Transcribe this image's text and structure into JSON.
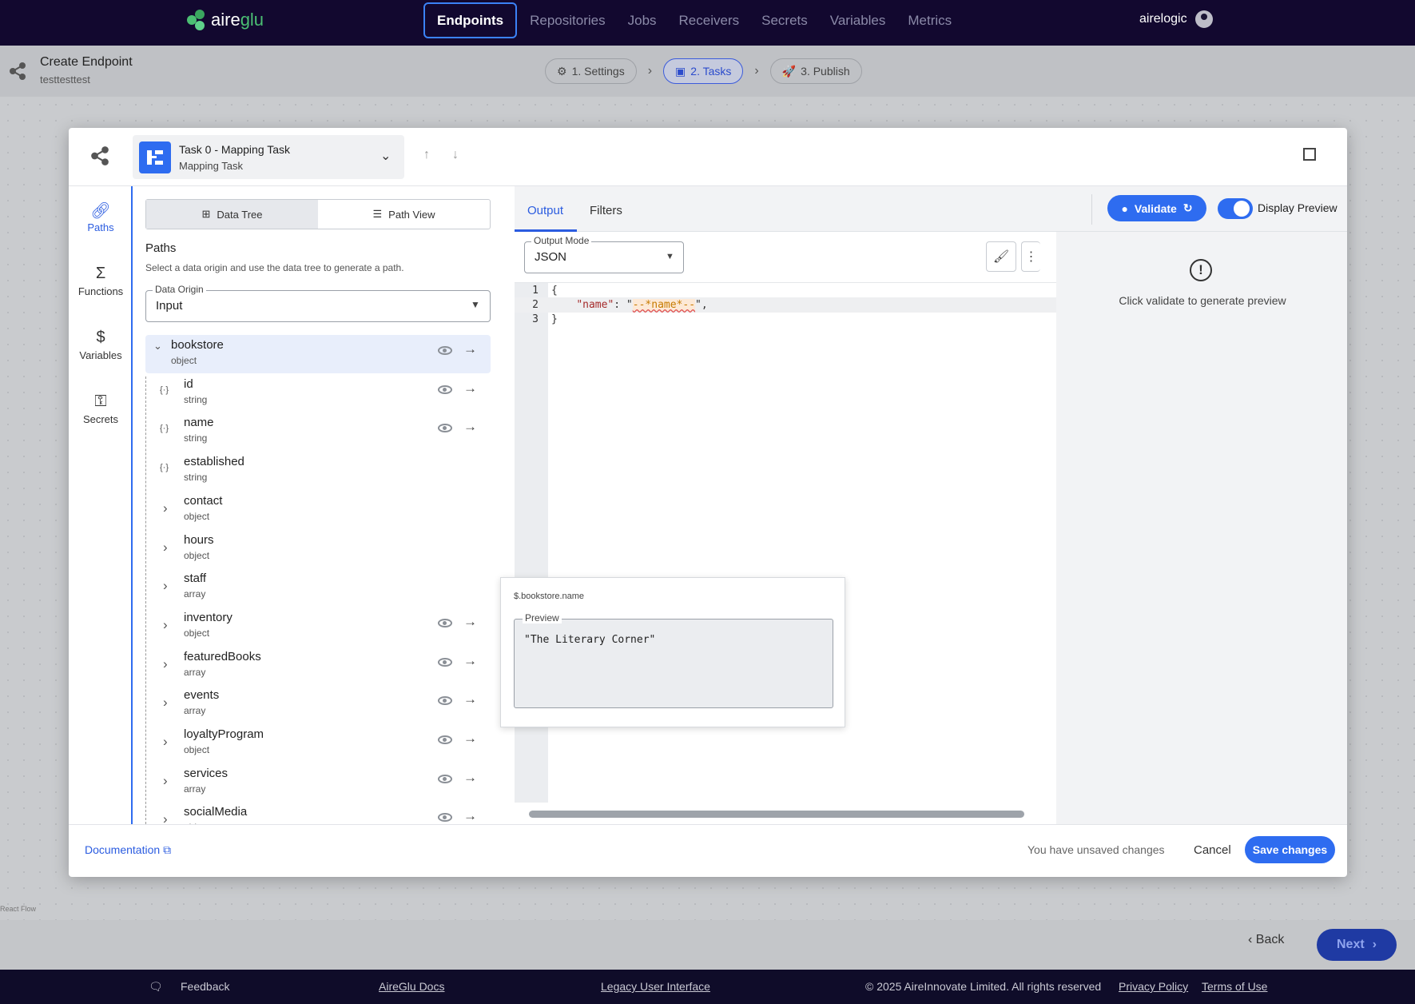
{
  "nav": {
    "logo": "aire",
    "logo_accent": "glu",
    "links": [
      "Endpoints",
      "Repositories",
      "Jobs",
      "Receivers",
      "Secrets",
      "Variables",
      "Metrics"
    ],
    "user": "airelogic"
  },
  "sub": {
    "title": "Create Endpoint",
    "subtitle": "testtesttest",
    "steps": [
      "1. Settings",
      "2. Tasks",
      "3. Publish"
    ]
  },
  "task": {
    "title": "Task 0 - Mapping Task",
    "subtitle": "Mapping Task"
  },
  "rail": [
    "Paths",
    "Functions",
    "Variables",
    "Secrets"
  ],
  "paths": {
    "view_tabs": [
      "Data Tree",
      "Path View"
    ],
    "title": "Paths",
    "desc": "Select a data origin and use the data tree to generate a path.",
    "origin_label": "Data Origin",
    "origin_value": "Input",
    "tree": [
      {
        "name": "bookstore",
        "type": "object"
      },
      {
        "name": "id",
        "type": "string"
      },
      {
        "name": "name",
        "type": "string"
      },
      {
        "name": "established",
        "type": "string"
      },
      {
        "name": "contact",
        "type": "object"
      },
      {
        "name": "hours",
        "type": "object"
      },
      {
        "name": "staff",
        "type": "array"
      },
      {
        "name": "inventory",
        "type": "object"
      },
      {
        "name": "featuredBooks",
        "type": "array"
      },
      {
        "name": "events",
        "type": "array"
      },
      {
        "name": "loyaltyProgram",
        "type": "object"
      },
      {
        "name": "services",
        "type": "array"
      },
      {
        "name": "socialMedia",
        "type": "object"
      }
    ]
  },
  "editor": {
    "tabs": [
      "Output",
      "Filters"
    ],
    "validate": "Validate",
    "display_preview": "Display Preview",
    "output_mode_label": "Output Mode",
    "output_mode": "JSON",
    "line1": "{",
    "line2_key": "\"name\"",
    "line2_colon": ": \"",
    "line2_ph": "--*name*--",
    "line2_end": "\",",
    "line3": "}"
  },
  "preview": {
    "message": "Click validate to generate preview"
  },
  "popover": {
    "path": "$.bookstore.name",
    "label": "Preview",
    "value": "\"The Literary Corner\""
  },
  "footer_modal": {
    "doc": "Documentation",
    "unsaved": "You have unsaved changes",
    "cancel": "Cancel",
    "save": "Save changes"
  },
  "bottom": {
    "back": "Back",
    "next": "Next",
    "react_flow": "React Flow"
  },
  "footer": {
    "feedback": "Feedback",
    "docs": "AireGlu Docs",
    "legacy": "Legacy User Interface",
    "copyright": "© 2025 AireInnovate Limited. All rights reserved",
    "privacy": "Privacy Policy",
    "terms": "Terms of Use"
  }
}
